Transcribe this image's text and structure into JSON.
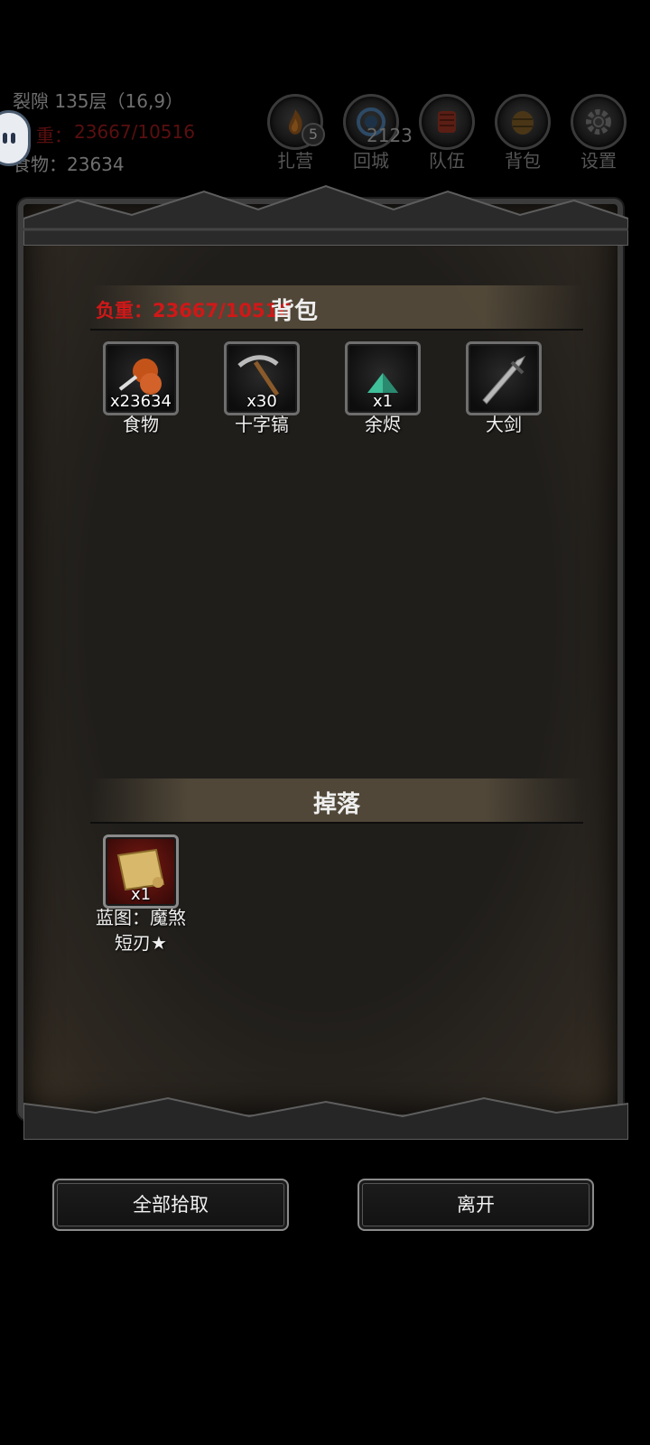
{
  "hud": {
    "location": "裂隙 135层（16,9）",
    "weight_label": "重：",
    "weight_value": "23667/10516",
    "food": "食物：23634"
  },
  "topnav": [
    {
      "label": "扎营",
      "icon": "campfire-icon",
      "badge": "5"
    },
    {
      "label": "回城",
      "icon": "portal-icon",
      "count": "2123"
    },
    {
      "label": "队伍",
      "icon": "team-icon"
    },
    {
      "label": "背包",
      "icon": "backpack-icon"
    },
    {
      "label": "设置",
      "icon": "gear-icon"
    }
  ],
  "bag": {
    "title": "背包",
    "weight": "负重：23667/10516",
    "items": [
      {
        "name": "食物",
        "qty": "x23634",
        "icon": "meat-icon"
      },
      {
        "name": "十字镐",
        "qty": "x30",
        "icon": "pickaxe-icon"
      },
      {
        "name": "余烬",
        "qty": "x1",
        "icon": "ember-icon"
      },
      {
        "name": "大剑",
        "qty": "",
        "icon": "greatsword-icon"
      }
    ]
  },
  "drop": {
    "title": "掉落",
    "items": [
      {
        "name": "蓝图：魔煞\n短刃★",
        "name_line1": "蓝图：魔煞",
        "name_line2": "短刃★",
        "qty": "x1",
        "icon": "scroll-icon"
      }
    ]
  },
  "buttons": {
    "pickup_all": "全部拾取",
    "leave": "离开"
  },
  "colors": {
    "weight_red": "#d01818",
    "panel_bg": "#201e1b"
  }
}
